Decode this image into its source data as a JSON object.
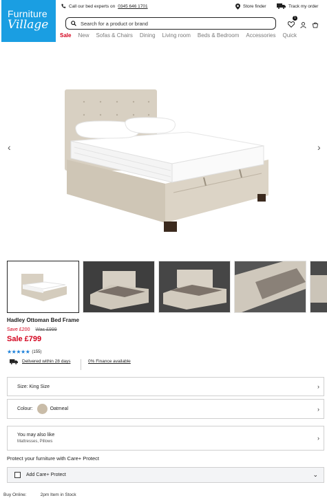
{
  "header": {
    "logo_line1": "Furniture",
    "logo_line2": "Village",
    "call_prefix": "Call our bed experts on",
    "call_number": "0345 646 1701",
    "store_finder": "Store finder",
    "track_order": "Track my order",
    "search_placeholder": "Search for a product or brand",
    "basket_count": "1"
  },
  "nav": [
    "Sale",
    "New",
    "Sofas & Chairs",
    "Dining",
    "Living room",
    "Beds & Bedroom",
    "Accessories",
    "Quick"
  ],
  "gallery": {
    "prev": "‹",
    "next": "›"
  },
  "product": {
    "title": "Hadley Ottoman Bed Frame",
    "save": "Save £200",
    "was": "Was £999",
    "sale_price": "Sale £799",
    "stars": "★★★★★",
    "reviews": "(155)",
    "delivery": "Delivered within 28 days",
    "finance": "0% Finance available"
  },
  "options": {
    "size": "Size: King Size",
    "colour_label": "Colour:",
    "colour_value": "Oatmeal",
    "also_title": "You may also like",
    "also_sub": "Mattresses, Pillows"
  },
  "care": {
    "title": "Protect your furniture with Care+ Protect",
    "add": "Add Care+ Protect"
  },
  "buy": {
    "label": "Buy Online:",
    "status": "2pm Item in Stock"
  },
  "colors": {
    "brand": "#1a9ee2",
    "sale": "#d3001c",
    "stars": "#1a7fd9",
    "fabric": "#d9d1c3"
  }
}
